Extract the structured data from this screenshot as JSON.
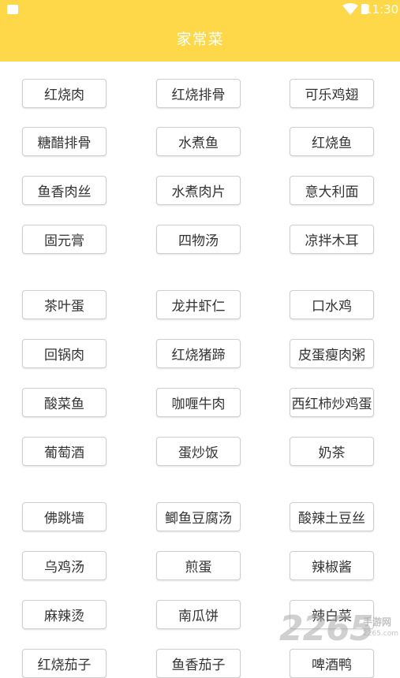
{
  "status_bar": {
    "time": "11:30"
  },
  "header": {
    "title": "家常菜",
    "color": "#FFD84A"
  },
  "dishes": [
    [
      "红烧肉",
      "红烧排骨",
      "可乐鸡翅"
    ],
    [
      "糖醋排骨",
      "水煮鱼",
      "红烧鱼"
    ],
    [
      "鱼香肉丝",
      "水煮肉片",
      "意大利面"
    ],
    [
      "固元膏",
      "四物汤",
      "凉拌木耳"
    ],
    [
      "茶叶蛋",
      "龙井虾仁",
      "口水鸡"
    ],
    [
      "回锅肉",
      "红烧猪蹄",
      "皮蛋瘦肉粥"
    ],
    [
      "酸菜鱼",
      "咖喱牛肉",
      "西红柿炒鸡蛋"
    ],
    [
      "葡萄酒",
      "蛋炒饭",
      "奶茶"
    ],
    [
      "佛跳墙",
      "鲫鱼豆腐汤",
      "酸辣土豆丝"
    ],
    [
      "乌鸡汤",
      "煎蛋",
      "辣椒酱"
    ],
    [
      "麻辣烫",
      "南瓜饼",
      "辣白菜"
    ],
    [
      "红烧茄子",
      "鱼香茄子",
      "啤酒鸭"
    ]
  ],
  "watermark": {
    "number": "2265",
    "text": "手游网",
    "url": "2265.com"
  }
}
